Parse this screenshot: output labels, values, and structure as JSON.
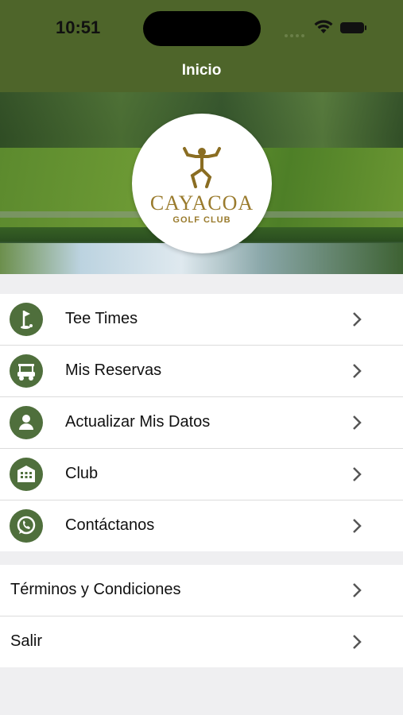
{
  "status_bar": {
    "time": "10:51"
  },
  "header": {
    "title": "Inicio"
  },
  "logo": {
    "name": "CAYACOA",
    "subtitle": "GOLF CLUB"
  },
  "menu": {
    "items": [
      {
        "label": "Tee Times",
        "icon": "golf-flag-icon"
      },
      {
        "label": "Mis Reservas",
        "icon": "golf-cart-icon"
      },
      {
        "label": "Actualizar Mis Datos",
        "icon": "user-icon"
      },
      {
        "label": "Club",
        "icon": "building-icon"
      },
      {
        "label": "Contáctanos",
        "icon": "whatsapp-icon"
      }
    ]
  },
  "secondary": {
    "items": [
      {
        "label": "Términos y Condiciones"
      },
      {
        "label": "Salir"
      }
    ]
  },
  "colors": {
    "header": "#4e652a",
    "icon_bg": "#4f6f3c",
    "logo_gold": "#9a7b2d",
    "background": "#efeff1"
  }
}
